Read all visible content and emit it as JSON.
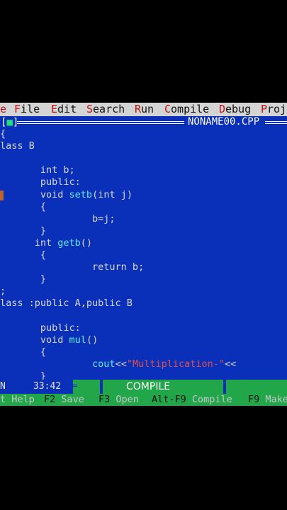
{
  "menu": {
    "items": [
      {
        "hotkey": "F",
        "rest": "ile"
      },
      {
        "hotkey": "E",
        "rest": "dit"
      },
      {
        "hotkey": "S",
        "rest": "earch"
      },
      {
        "hotkey": "R",
        "rest": "un"
      },
      {
        "hotkey": "C",
        "rest": "ompile"
      },
      {
        "hotkey": "D",
        "rest": "ebug"
      },
      {
        "hotkey": "P",
        "rest": "roj"
      }
    ],
    "edge_char": "e"
  },
  "window": {
    "close_box": "[",
    "close_dot": "■",
    "close_end": "]",
    "filename": "NONAME00.CPP"
  },
  "code": {
    "lines": [
      {
        "segments": [
          {
            "t": "{",
            "c": "txt"
          }
        ]
      },
      {
        "segments": [
          {
            "t": "lass B",
            "c": "txt"
          }
        ]
      },
      {
        "segments": [
          {
            "t": "",
            "c": "txt"
          }
        ]
      },
      {
        "segments": [
          {
            "t": "       int b;",
            "c": "txt"
          }
        ]
      },
      {
        "segments": [
          {
            "t": "       public:",
            "c": "txt"
          }
        ]
      },
      {
        "segments": [
          {
            "t": "       void ",
            "c": "txt"
          },
          {
            "t": "setb",
            "c": "fn"
          },
          {
            "t": "(int j)",
            "c": "txt"
          }
        ]
      },
      {
        "segments": [
          {
            "t": "       {",
            "c": "txt"
          }
        ]
      },
      {
        "segments": [
          {
            "t": "                b=j;",
            "c": "txt"
          }
        ]
      },
      {
        "segments": [
          {
            "t": "       }",
            "c": "txt"
          }
        ]
      },
      {
        "segments": [
          {
            "t": "      int ",
            "c": "txt"
          },
          {
            "t": "getb",
            "c": "fn"
          },
          {
            "t": "()",
            "c": "txt"
          }
        ]
      },
      {
        "segments": [
          {
            "t": "       {",
            "c": "txt"
          }
        ]
      },
      {
        "segments": [
          {
            "t": "                return b;",
            "c": "txt"
          }
        ]
      },
      {
        "segments": [
          {
            "t": "       }",
            "c": "txt"
          }
        ]
      },
      {
        "segments": [
          {
            "t": ";",
            "c": "txt"
          }
        ]
      },
      {
        "segments": [
          {
            "t": "lass :public A,public B",
            "c": "txt"
          }
        ]
      },
      {
        "segments": [
          {
            "t": "",
            "c": "txt"
          }
        ]
      },
      {
        "segments": [
          {
            "t": "       public:",
            "c": "txt"
          }
        ]
      },
      {
        "segments": [
          {
            "t": "       void ",
            "c": "txt"
          },
          {
            "t": "mul",
            "c": "fn"
          },
          {
            "t": "()",
            "c": "txt"
          }
        ]
      },
      {
        "segments": [
          {
            "t": "       {",
            "c": "txt"
          }
        ]
      },
      {
        "segments": [
          {
            "t": "                ",
            "c": "txt"
          },
          {
            "t": "cout",
            "c": "fn"
          },
          {
            "t": "<<",
            "c": "txt"
          },
          {
            "t": "\"Multiplication-\"",
            "c": "str"
          },
          {
            "t": "<<",
            "c": "txt"
          }
        ]
      },
      {
        "segments": [
          {
            "t": "       }",
            "c": "txt"
          }
        ]
      }
    ]
  },
  "status": {
    "mode_char": "N",
    "position": "33:42",
    "compile_label": "COMPILE"
  },
  "hints": [
    {
      "key": "",
      "label": "t Help"
    },
    {
      "key": "F2",
      "label": " Save"
    },
    {
      "key": "F3",
      "label": " Open"
    },
    {
      "key": "Alt-F9",
      "label": " Compile"
    },
    {
      "key": "F9",
      "label": " Make"
    }
  ],
  "colors": {
    "editor_bg": "#0a2fb8",
    "menu_bg": "#d4d4d4",
    "hotkey": "#c01010",
    "status_bg": "#21a74a",
    "string": "#e05050",
    "identifier": "#62e9e9"
  }
}
